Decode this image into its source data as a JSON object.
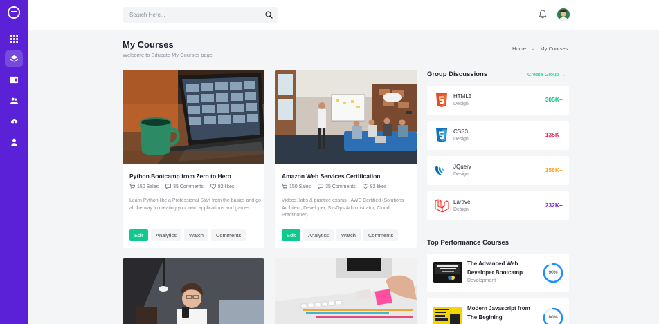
{
  "search": {
    "placeholder": "Search Here..."
  },
  "sidebar": {
    "items": [
      {
        "icon": "grid-icon"
      },
      {
        "icon": "layers-icon",
        "active": true
      },
      {
        "icon": "wallet-icon"
      },
      {
        "icon": "cloud-users-icon"
      },
      {
        "icon": "cloud-upload-icon"
      },
      {
        "icon": "user-icon"
      }
    ]
  },
  "page": {
    "title": "My Courses",
    "subtitle": "Welcome to Educate My Courses page"
  },
  "breadcrumb": {
    "home": "Home",
    "separator": ">",
    "current": "My Courses"
  },
  "courses": [
    {
      "title": "Python Bootcamp from Zero to Hero",
      "sales": "150 Sales",
      "comments": "35 Comments",
      "likes": "82 likes",
      "description": "Learn Python like a Professional Start from the basics and go all the way to creating your own applications and games",
      "actions": {
        "edit": "Edit",
        "analytics": "Analytics",
        "watch": "Watch",
        "comments": "Comments"
      }
    },
    {
      "title": "Amazon Web Services Certification",
      "sales": "150 Sales",
      "comments": "35 Comments",
      "likes": "82 likes",
      "description": "Videos, labs & practice exams - AWS Certified (Solutions Architect, Developer, SysOps Administrator, Cloud Practitioner)",
      "actions": {
        "edit": "Edit",
        "analytics": "Analytics",
        "watch": "Watch",
        "comments": "Comments"
      }
    }
  ],
  "group_discussions": {
    "title": "Group Discussions",
    "create_label": "Create Group →",
    "items": [
      {
        "name": "HTML5",
        "category": "Design",
        "count": "305K+",
        "color": "#10c98f",
        "icon": "html5-icon"
      },
      {
        "name": "CSS3",
        "category": "Design",
        "count": "135K+",
        "color": "#e5245a",
        "icon": "css3-icon"
      },
      {
        "name": "JQuery",
        "category": "Design",
        "count": "158K+",
        "color": "#f5a623",
        "icon": "jquery-icon"
      },
      {
        "name": "Laravel",
        "category": "Design",
        "count": "232K+",
        "color": "#6b21d6",
        "icon": "laravel-icon"
      }
    ]
  },
  "top_performance": {
    "title": "Top Performance Courses",
    "items": [
      {
        "title": "The Advanced Web Developer Bootcamp",
        "category": "Development",
        "progress": 90,
        "progress_label": "90%"
      },
      {
        "title": "Modern Javascript from The Begining",
        "category": "",
        "progress": 80,
        "progress_label": "80%"
      }
    ]
  },
  "colors": {
    "brand": "#5b21d6",
    "accent": "#10c98f",
    "ring": "#1e90ff"
  }
}
